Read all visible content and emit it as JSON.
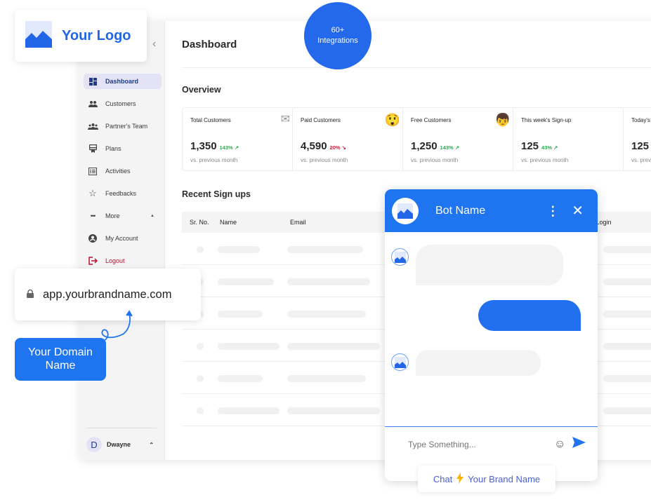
{
  "logo": {
    "text": "Your Logo",
    "icon": "image-icon"
  },
  "integrations_badge": {
    "line1": "60+",
    "line2": "Integrations"
  },
  "sidebar": {
    "collapse_icon": "chevron-left-icon",
    "items": [
      {
        "label": "Dashboard",
        "icon": "dashboard-icon",
        "active": true
      },
      {
        "label": "Customers",
        "icon": "customers-icon"
      },
      {
        "label": "Partner's Team",
        "icon": "team-icon"
      },
      {
        "label": "Plans",
        "icon": "plans-icon"
      },
      {
        "label": "Activities",
        "icon": "activities-icon"
      },
      {
        "label": "Feedbacks",
        "icon": "star-icon"
      },
      {
        "label": "More",
        "icon": "more-icon",
        "caret": "▲"
      },
      {
        "label": "My Account",
        "icon": "account-icon"
      },
      {
        "label": "Logout",
        "icon": "logout-icon"
      }
    ],
    "user": {
      "initial": "D",
      "name": "Dwayne",
      "caret": "⌃"
    }
  },
  "main": {
    "title": "Dashboard",
    "overview_title": "Overview",
    "stats": [
      {
        "label": "Total Customers",
        "emoji": "✉",
        "value": "1,350",
        "change": "143%",
        "direction": "up",
        "arrow": "↗",
        "sub": "vs. previous month"
      },
      {
        "label": "Paid Customers",
        "emoji": "😲",
        "value": "4,590",
        "change": "20%",
        "direction": "down",
        "arrow": "↘",
        "sub": "vs. previous month"
      },
      {
        "label": "Free Customers",
        "emoji": "👦",
        "value": "1,250",
        "change": "143%",
        "direction": "up",
        "arrow": "↗",
        "sub": "vs. previous month"
      },
      {
        "label": "This week's Sign-up",
        "emoji": "",
        "value": "125",
        "change": "43%",
        "direction": "up",
        "arrow": "↗",
        "sub": "vs. previous month"
      },
      {
        "label": "Today's",
        "emoji": "",
        "value": "125",
        "change": "",
        "direction": "up",
        "arrow": "",
        "sub": "vs. previ"
      }
    ],
    "recent_title": "Recent Sign ups",
    "table": {
      "columns": [
        "Sr. No.",
        "Name",
        "Email",
        "st Login"
      ],
      "row_count": 6
    }
  },
  "domain": {
    "url": "app.yourbrandname.com",
    "lock_icon": "lock-icon",
    "label_line1": "Your Domain",
    "label_line2": "Name"
  },
  "chat": {
    "bot_name": "Bot Name",
    "input_placeholder": "Type Something...",
    "powered_prefix": "Chat",
    "powered_brand": "Your Brand Name",
    "colors": {
      "primary": "#1f74f0",
      "bubble": "#f3f3f3"
    }
  }
}
